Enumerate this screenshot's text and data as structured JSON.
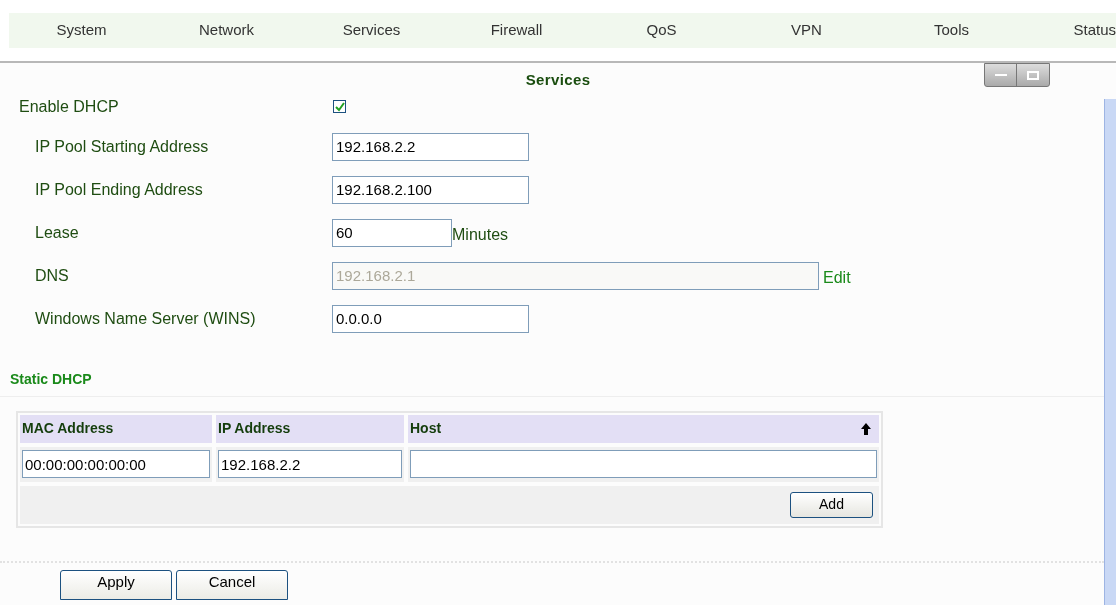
{
  "nav": [
    "System",
    "Network",
    "Services",
    "Firewall",
    "QoS",
    "VPN",
    "Tools",
    "Status"
  ],
  "panel": {
    "title": "Services"
  },
  "enable_dhcp": {
    "label": "Enable DHCP",
    "checked": true
  },
  "fields": [
    {
      "label": "IP Pool Starting Address",
      "value": "192.168.2.2",
      "disabled": false
    },
    {
      "label": "IP Pool Ending Address",
      "value": "192.168.2.100",
      "disabled": false
    },
    {
      "label": "Lease",
      "value": "60",
      "disabled": false,
      "suffix": "Minutes"
    },
    {
      "label": "DNS",
      "value": "192.168.2.1",
      "disabled": true,
      "link": "Edit"
    },
    {
      "label": "Windows Name Server (WINS)",
      "value": "0.0.0.0",
      "disabled": false
    }
  ],
  "static_dhcp": {
    "heading": "Static DHCP",
    "columns": [
      "MAC Address",
      "IP Address",
      "Host"
    ],
    "row": [
      "00:00:00:00:00:00",
      "192.168.2.2"
    ],
    "add_button": "Add"
  },
  "buttons": [
    "Apply",
    "Cancel"
  ]
}
